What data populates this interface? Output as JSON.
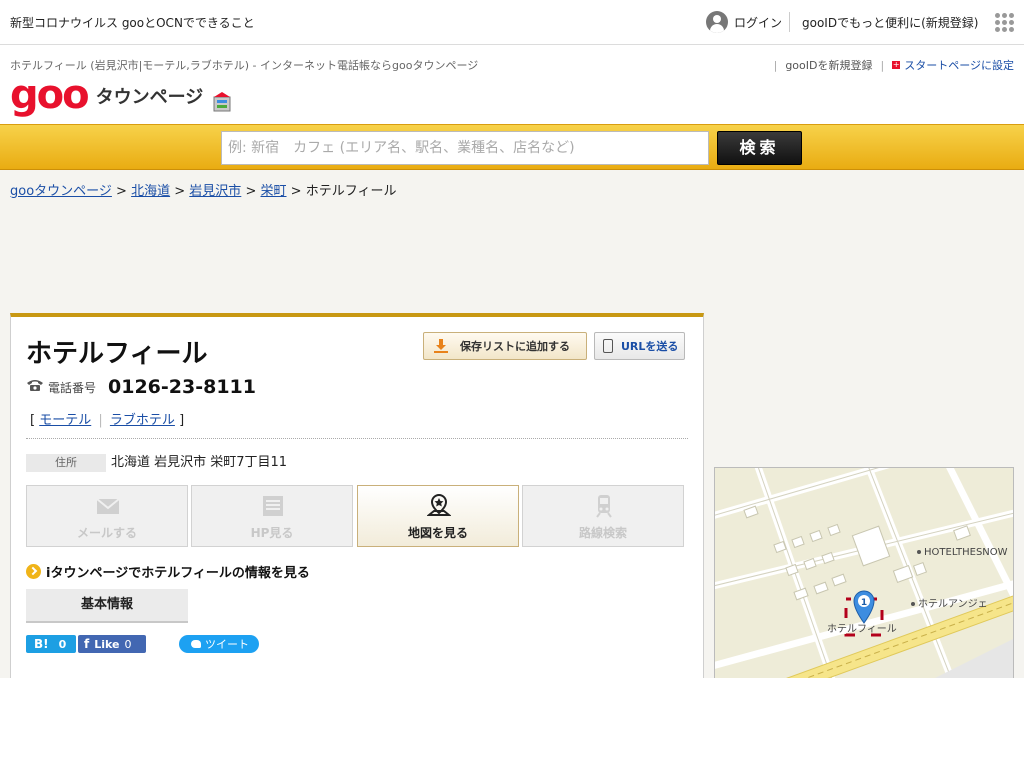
{
  "topbar": {
    "notice": "新型コロナウイルス gooとOCNでできること",
    "login": "ログイン",
    "register": "gooIDでもっと便利に(新規登録)"
  },
  "header": {
    "subtitle": "ホテルフィール (岩見沢市|モーテル,ラブホテル) - インターネット電話帳ならgooタウンページ",
    "logo_goo": "goo",
    "logo_text": "タウンページ",
    "links": {
      "new_id": "gooIDを新規登録",
      "startpage": "スタートページに設定"
    }
  },
  "search": {
    "placeholder": "例: 新宿　カフェ (エリア名、駅名、業種名、店名など)",
    "button": "検索"
  },
  "breadcrumb": {
    "items": [
      "gooタウンページ",
      "北海道",
      "岩見沢市",
      "栄町"
    ],
    "separator": ">",
    "current": "ホテルフィール"
  },
  "listing": {
    "name": "ホテルフィール",
    "save_button": "保存リストに追加する",
    "url_button": "URLを送る",
    "phone_label": "電話番号",
    "phone": "0126-23-8111",
    "categories": [
      "モーテル",
      "ラブホテル"
    ],
    "bracket_open": "[",
    "bracket_close": "]",
    "address_label": "住所",
    "address": "北海道 岩見沢市 栄町7丁目11",
    "actions": [
      {
        "label": "メールする",
        "active": false
      },
      {
        "label": "HP見る",
        "active": false
      },
      {
        "label": "地図を見る",
        "active": true
      },
      {
        "label": "路線検索",
        "active": false
      }
    ],
    "itownpage_link": "iタウンページでホテルフィールの情報を見る",
    "tab_basic": "基本情報",
    "share": {
      "hatena_count": "0",
      "fb_like": "Like",
      "fb_count": "0",
      "tweet": "ツイート"
    }
  },
  "map": {
    "labels": [
      "HOTELTHESNOW",
      "ホテルアンジェ",
      "ホテルフィール"
    ],
    "marker_number": "1",
    "colors": {
      "marker": "#3d8de0",
      "marker_frame": "#b3001b",
      "land": "#eeecd8",
      "road": "#ffffff",
      "rail": "#f6e58a"
    }
  },
  "colors": {
    "brand_red": "#e8112d",
    "search_bar": "#f0c02a",
    "link": "#1a4ea6",
    "card_accent": "#c89812"
  }
}
